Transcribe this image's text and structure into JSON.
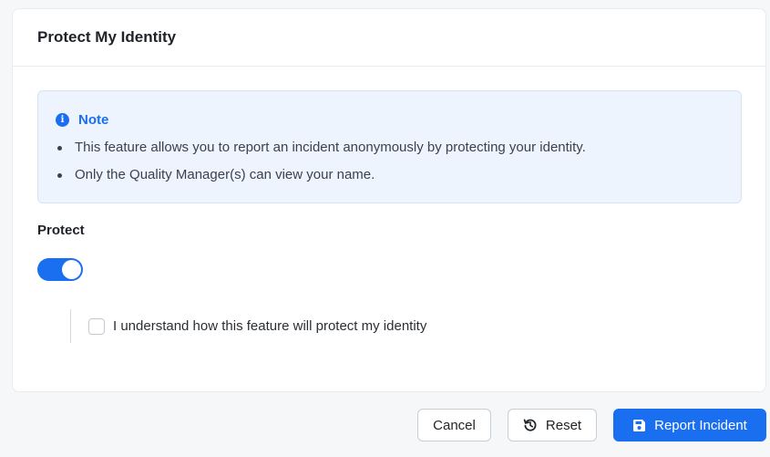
{
  "card": {
    "title": "Protect My Identity"
  },
  "note": {
    "icon": "info-icon",
    "icon_glyph": "i",
    "title": "Note",
    "items": [
      "This feature allows you to report an incident anonymously by protecting your identity.",
      "Only the Quality Manager(s) can view your name."
    ]
  },
  "protect": {
    "label": "Protect",
    "enabled": true,
    "acknowledge_label": "I understand how this feature will protect my identity",
    "acknowledge_checked": false
  },
  "actions": {
    "cancel_label": "Cancel",
    "reset_label": "Reset",
    "reset_icon": "history-icon",
    "submit_label": "Report Incident",
    "submit_icon": "save-icon"
  },
  "colors": {
    "primary": "#1a6ef0",
    "note_background": "#eef4fd"
  }
}
